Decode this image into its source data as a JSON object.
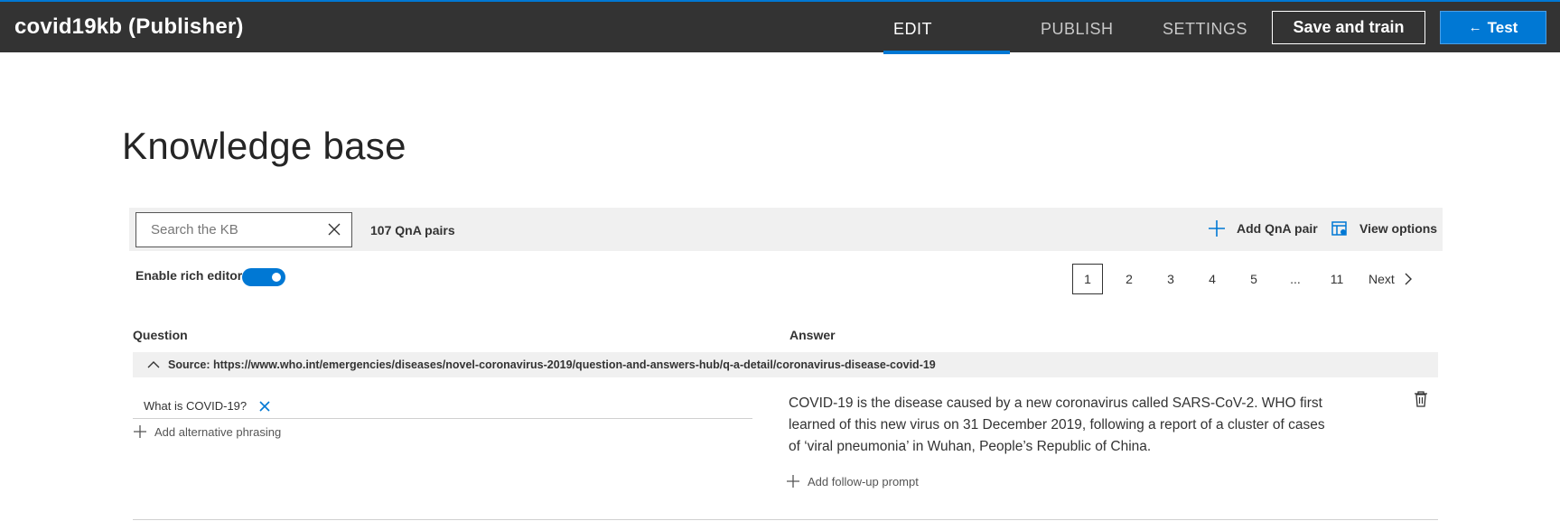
{
  "app": {
    "title": "covid19kb (Publisher)",
    "nav": {
      "edit": "EDIT",
      "publish": "PUBLISH",
      "settings": "SETTINGS"
    },
    "save_label": "Save and train",
    "test_label": "Test",
    "accent_color": "#0078d4"
  },
  "page": {
    "title": "Knowledge base"
  },
  "toolbar": {
    "search_placeholder": "Search the KB",
    "qna_count": "107 QnA pairs",
    "add_qna": "Add QnA pair",
    "view_options": "View options"
  },
  "editor": {
    "rich_editor_label": "Enable rich editor",
    "rich_editor_enabled": true
  },
  "pagination": {
    "pages": [
      "1",
      "2",
      "3",
      "4",
      "5",
      "...",
      "11"
    ],
    "current": "1",
    "next": "Next"
  },
  "table": {
    "question_header": "Question",
    "answer_header": "Answer",
    "source": "Source: https://www.who.int/emergencies/diseases/novel-coronavirus-2019/question-and-answers-hub/q-a-detail/coronavirus-disease-covid-19",
    "rows": [
      {
        "question": "What is COVID-19?",
        "add_alternative": "Add alternative phrasing",
        "answer": "COVID-19 is the disease caused by a new coronavirus called SARS-CoV-2. WHO first learned of this new virus on 31 December 2019, following a report of a cluster of cases of ‘viral pneumonia’ in Wuhan, People’s Republic of China.",
        "add_follow_up": "Add follow-up prompt"
      }
    ]
  },
  "icons": {
    "clear": "close-icon",
    "add": "plus-icon",
    "view_options": "view-options-icon",
    "next": "chevron-right-icon",
    "collapse": "chevron-up-icon",
    "delete": "trash-icon",
    "test_arrow": "arrow-left-icon"
  }
}
